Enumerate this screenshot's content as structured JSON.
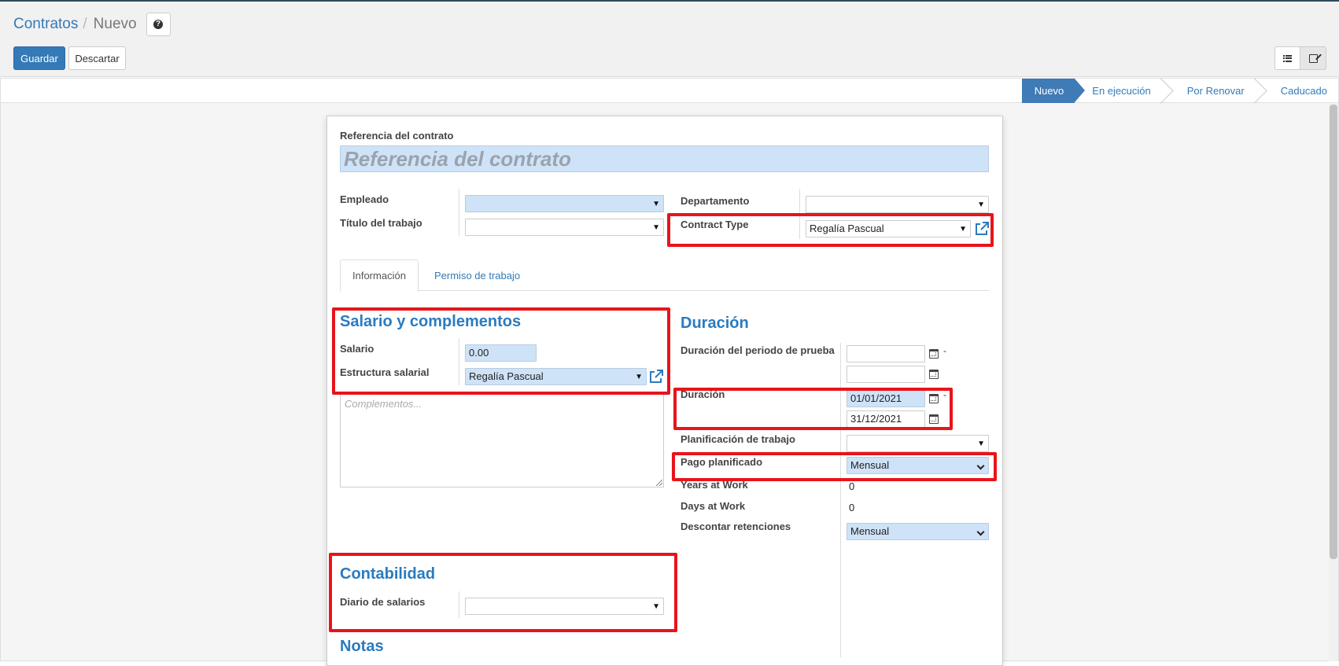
{
  "breadcrumb": {
    "parent": "Contratos",
    "separator": "/",
    "current": "Nuevo",
    "help_icon": "?"
  },
  "toolbar": {
    "save_label": "Guardar",
    "discard_label": "Descartar"
  },
  "view_switcher": {
    "list_icon": "list-icon",
    "form_icon": "edit-icon"
  },
  "statusbar": {
    "stages": [
      "Nuevo",
      "En ejecución",
      "Por Renovar",
      "Caducado"
    ],
    "active": "Nuevo"
  },
  "form": {
    "reference_label": "Referencia del contrato",
    "reference_placeholder": "Referencia del contrato",
    "employee_label": "Empleado",
    "employee_value": "",
    "job_title_label": "Título del trabajo",
    "job_title_value": "",
    "department_label": "Departamento",
    "department_value": "",
    "contract_type_label": "Contract Type",
    "contract_type_value": "Regalía Pascual",
    "tabs": [
      "Información",
      "Permiso de trabajo"
    ],
    "salary_section_title": "Salario y complementos",
    "salary_label": "Salario",
    "salary_value": "0.00",
    "salary_structure_label": "Estructura salarial",
    "salary_structure_value": "Regalía Pascual",
    "complements_placeholder": "Complementos...",
    "duration_section_title": "Duración",
    "trial_period_label": "Duración del periodo de prueba",
    "trial_start": "",
    "trial_end": "",
    "range_dash": "-",
    "duration_label": "Duración",
    "duration_start": "01/01/2021",
    "duration_end": "31/12/2021",
    "work_schedule_label": "Planificación de trabajo",
    "work_schedule_value": "",
    "scheduled_pay_label": "Pago planificado",
    "scheduled_pay_value": "Mensual",
    "years_at_work_label": "Years at Work",
    "years_at_work_value": "0",
    "days_at_work_label": "Days at Work",
    "days_at_work_value": "0",
    "withholding_label": "Descontar retenciones",
    "withholding_value": "Mensual",
    "accounting_section_title": "Contabilidad",
    "salary_journal_label": "Diario de salarios",
    "salary_journal_value": "",
    "notes_section_title": "Notas"
  },
  "colors": {
    "primary": "#337ab7",
    "highlight_box": "#e8141b",
    "section_title": "#2a7bbf",
    "required_field": "#cfe3f8"
  }
}
